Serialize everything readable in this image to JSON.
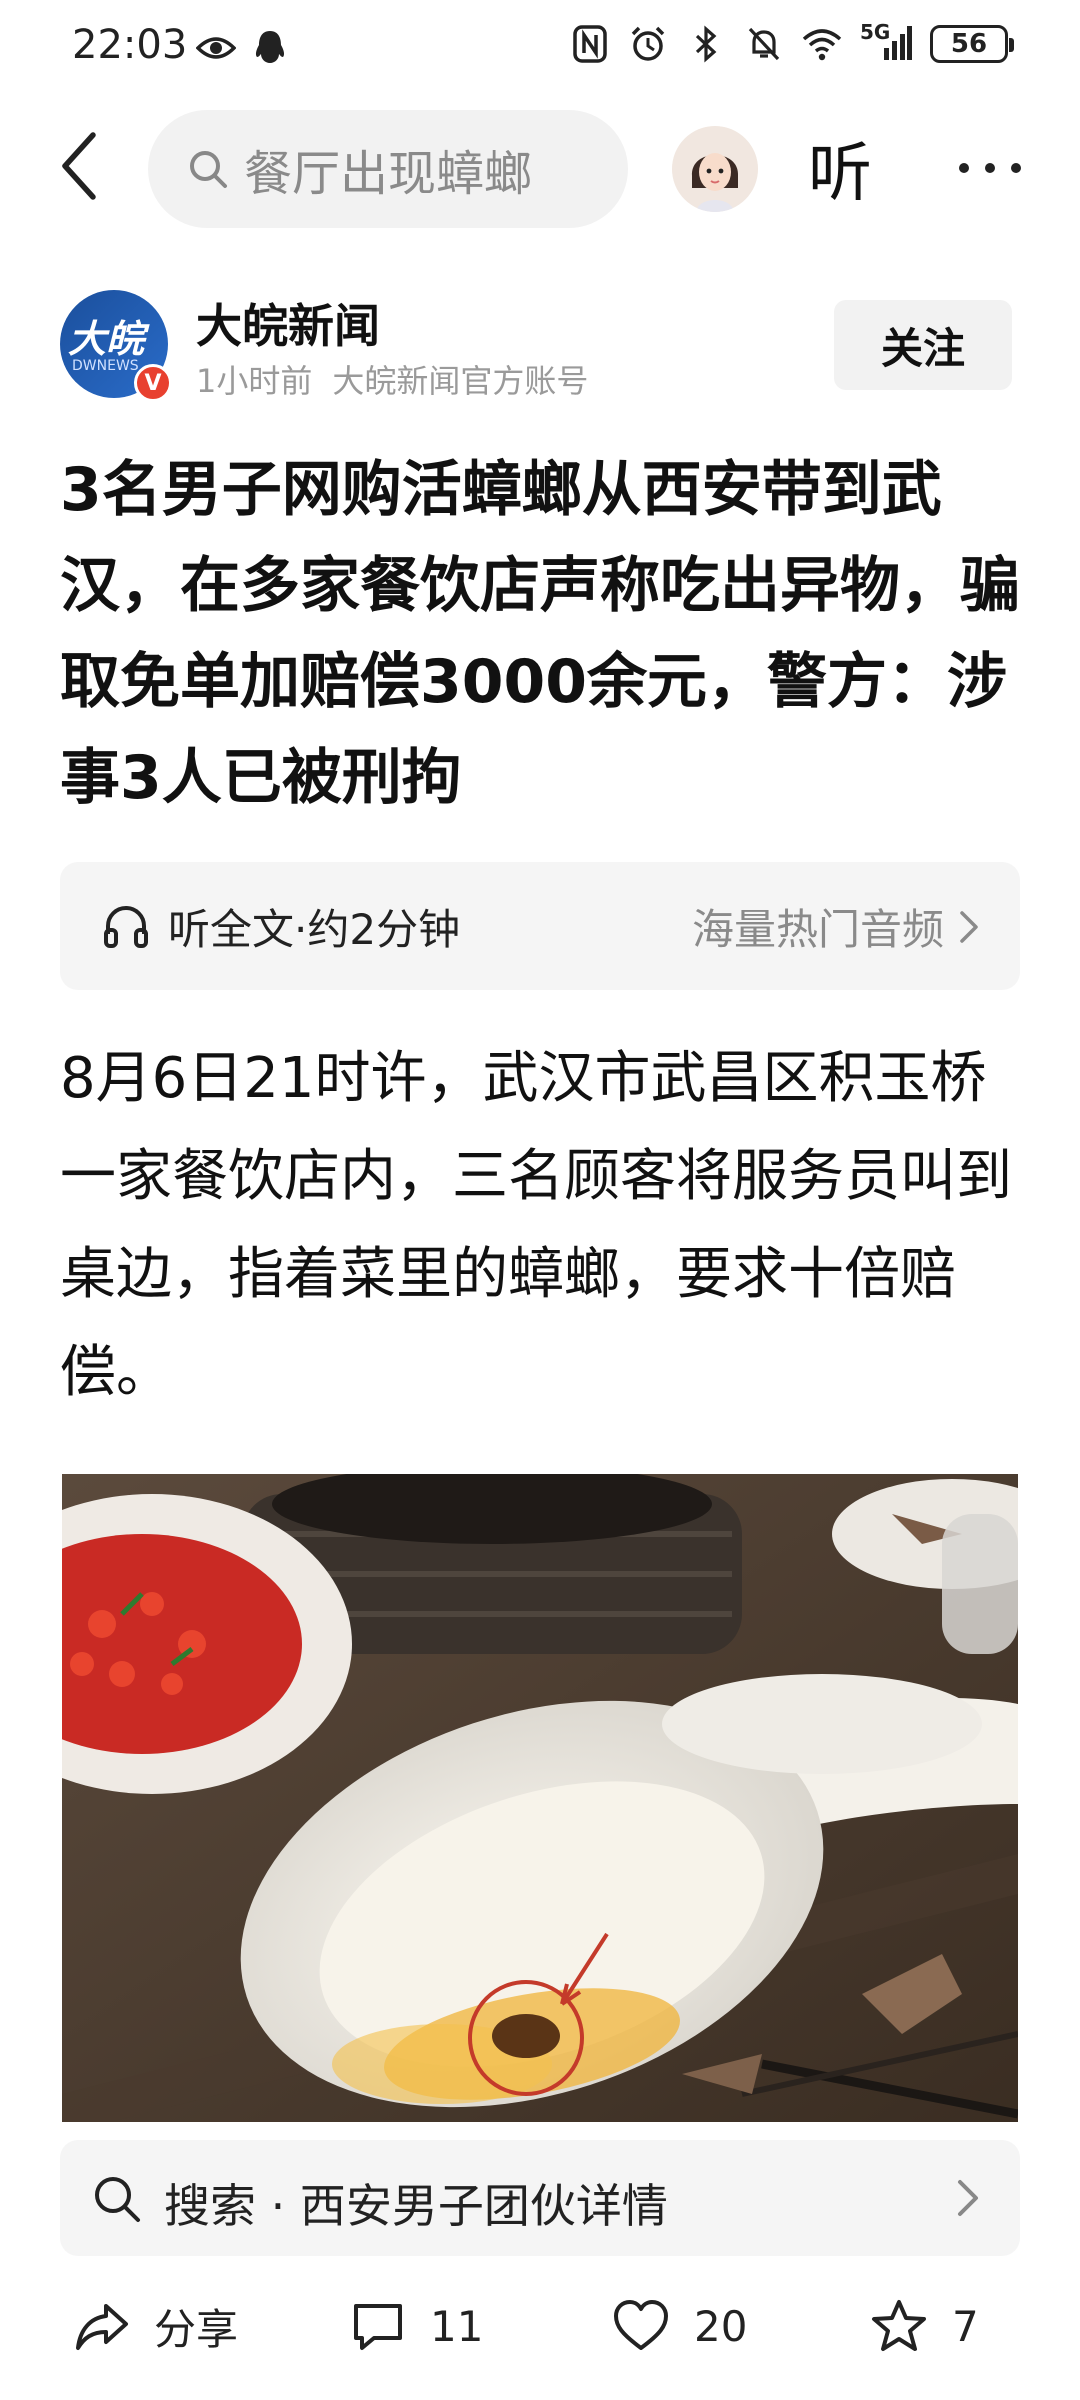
{
  "status_bar": {
    "time": "22:03",
    "network": "5G",
    "battery": "56"
  },
  "nav": {
    "search_query": "餐厅出现蟑螂",
    "listen_label": "听"
  },
  "author": {
    "name": "大皖新闻",
    "logo_text": "大皖",
    "logo_sub": "DWNEWS",
    "time_ago": "1小时前",
    "account_type": "大皖新闻官方账号",
    "follow_label": "关注"
  },
  "article": {
    "title": "3名男子网购活蟑螂从西安带到武汉，在多家餐饮店声称吃出异物，骗取免单加赔偿3000余元，警方：涉事3人已被刑拘",
    "listen_text": "听全文·约2分钟",
    "listen_more": "海量热门音频",
    "body": "8月6日21时许，武汉市武昌区积玉桥一家餐饮店内，三名顾客将服务员叫到桌边，指着菜里的蟑螂，要求十倍赔偿。"
  },
  "related_search": {
    "label": "搜索 · 西安男子团伙详情"
  },
  "actions": {
    "share_label": "分享",
    "comment_count": "11",
    "like_count": "20",
    "favorite_count": "7"
  }
}
